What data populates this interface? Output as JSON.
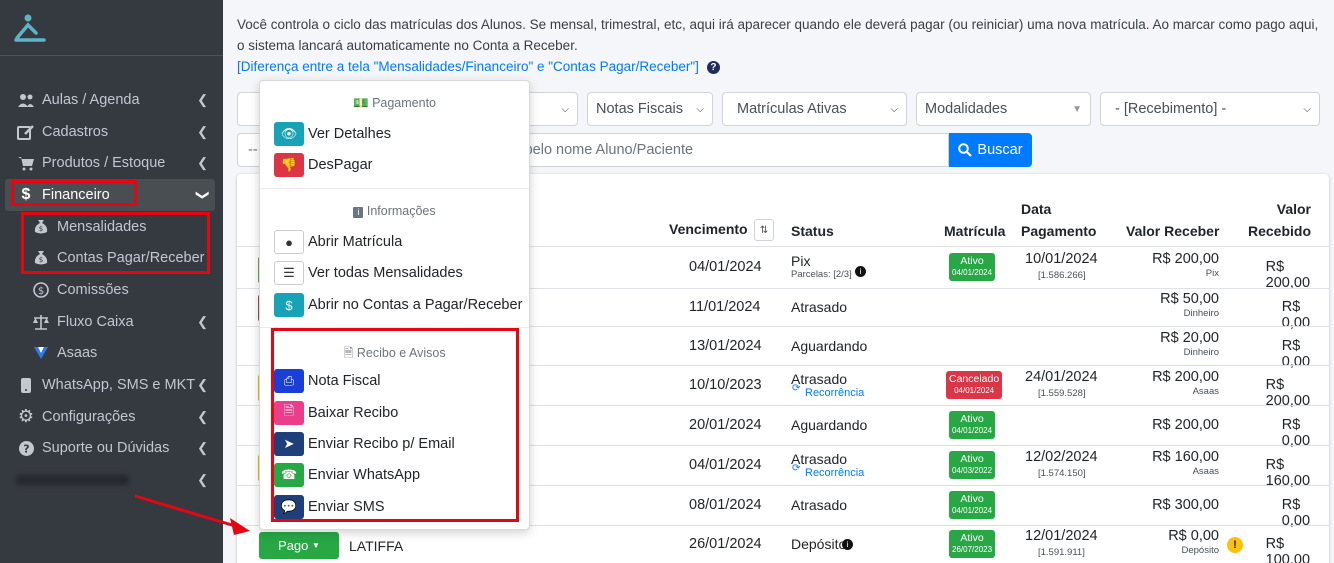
{
  "colors": {
    "sidebar": "#343a40",
    "primary": "#007bff",
    "success": "#28a745",
    "danger": "#dc3545",
    "annotation": "#e30613"
  },
  "sidebar": {
    "items": [
      {
        "label": "Aulas / Agenda",
        "icon": "users-icon"
      },
      {
        "label": "Cadastros",
        "icon": "edit-icon"
      },
      {
        "label": "Produtos / Estoque",
        "icon": "cart-icon"
      },
      {
        "label": "Financeiro",
        "icon": "dollar-icon"
      },
      {
        "label": "Mensalidades",
        "icon": "money-bag-icon"
      },
      {
        "label": "Contas Pagar/Receber",
        "icon": "money-bag-icon"
      },
      {
        "label": "Comissões",
        "icon": "dollar-circle-icon"
      },
      {
        "label": "Fluxo Caixa",
        "icon": "balance-icon"
      },
      {
        "label": "Asaas",
        "icon": "asaas-icon"
      },
      {
        "label": "WhatsApp, SMS e MKT",
        "icon": "mobile-icon"
      },
      {
        "label": "Configurações",
        "icon": "gear-icon"
      },
      {
        "label": "Suporte ou Dúvidas",
        "icon": "question-icon"
      }
    ]
  },
  "intro": {
    "text": "Você controla o ciclo das matrículas dos Alunos. Se mensal, trimestral, etc, aqui irá aparecer quando ele deverá pagar (ou reiniciar) uma nova matrícula. Ao marcar como pago aqui, o sistema lancará automaticamente no Conta a Receber.",
    "link": "[Diferença entre a tela \"Mensalidades/Financeiro\" e \"Contas Pagar/Receber\"]"
  },
  "filters": {
    "notas": "Notas Fiscais",
    "matriculas": "Matrículas Ativas",
    "modalidades": "Modalidades",
    "recebimento": "- [Recebimento] -",
    "dash": "--",
    "search_placeholder": "ar pelo nome Aluno/Paciente",
    "buscar": "Buscar"
  },
  "table": {
    "headers": {
      "vencimento": "Vencimento",
      "status": "Status",
      "matricula": "Matrícula",
      "data_pagamento_1": "Data",
      "data_pagamento_2": "Pagamento",
      "valor_receber": "Valor Receber",
      "valor_recebido_1": "Valor",
      "valor_recebido_2": "Recebido"
    },
    "rows": [
      {
        "venc": "04/01/2024",
        "status": "Pix",
        "status_sub": "Parcelas: [2/3]",
        "mat": "Ativo",
        "mat_date": "04/01/2024",
        "mat_color": "green",
        "pag": "10/01/2024",
        "pag_sub": "[1.586.266]",
        "receber": "R$ 200,00",
        "receber_sub": "Pix",
        "recebido": "R$ 200,00"
      },
      {
        "venc": "11/01/2024",
        "status": "Atrasado",
        "status_sub": "",
        "mat": "",
        "mat_date": "",
        "mat_color": "",
        "pag": "",
        "pag_sub": "",
        "receber": "R$ 50,00",
        "receber_sub": "Dinheiro",
        "recebido": "R$ 0,00"
      },
      {
        "venc": "13/01/2024",
        "status": "Aguardando",
        "status_sub": "",
        "mat": "",
        "mat_date": "",
        "mat_color": "",
        "pag": "",
        "pag_sub": "",
        "receber": "R$ 20,00",
        "receber_sub": "Dinheiro",
        "recebido": "R$ 0,00"
      },
      {
        "venc": "10/10/2023",
        "status": "Atrasado",
        "status_sub": "Recorrência",
        "mat": "Cancelado",
        "mat_date": "04/01/2024",
        "mat_color": "red",
        "pag": "24/01/2024",
        "pag_sub": "[1.559.528]",
        "receber": "R$ 200,00",
        "receber_sub": "Asaas",
        "recebido": "R$ 200,00"
      },
      {
        "venc": "20/01/2024",
        "status": "Aguardando",
        "status_sub": "",
        "mat": "Ativo",
        "mat_date": "04/01/2024",
        "mat_color": "green",
        "pag": "",
        "pag_sub": "",
        "receber": "R$ 200,00",
        "receber_sub": "",
        "recebido": "R$ 0,00"
      },
      {
        "venc": "04/01/2024",
        "status": "Atrasado",
        "status_sub": "Recorrência",
        "mat": "Ativo",
        "mat_date": "04/03/2022",
        "mat_color": "green",
        "pag": "12/02/2024",
        "pag_sub": "[1.574.150]",
        "receber": "R$ 160,00",
        "receber_sub": "Asaas",
        "recebido": "R$ 160,00"
      },
      {
        "venc": "08/01/2024",
        "status": "Atrasado",
        "status_sub": "",
        "mat": "Ativo",
        "mat_date": "04/01/2024",
        "mat_color": "green",
        "pag": "",
        "pag_sub": "",
        "receber": "R$ 300,00",
        "receber_sub": "",
        "recebido": "R$ 0,00"
      },
      {
        "venc": "26/01/2024",
        "status": "Depósito",
        "status_sub": "",
        "mat": "Ativo",
        "mat_date": "26/07/2023",
        "mat_color": "green",
        "pag": "12/01/2024",
        "pag_sub": "[1.591.911]",
        "receber": "R$ 0,00",
        "receber_sub": "Depósito",
        "recebido": "R$ 100,00",
        "name": "LATIFFA"
      }
    ]
  },
  "dropdown": {
    "pagamento": "Pagamento",
    "ver_detalhes": "Ver Detalhes",
    "despagar": "DesPagar",
    "informacoes": "Informações",
    "abrir_matricula": "Abrir Matrícula",
    "ver_mensalidades": "Ver todas Mensalidades",
    "abrir_contas": "Abrir no Contas a Pagar/Receber",
    "recibo": "Recibo e Avisos",
    "nota_fiscal": "Nota Fiscal",
    "baixar_recibo": "Baixar Recibo",
    "enviar_email": "Enviar Recibo p/ Email",
    "enviar_whatsapp": "Enviar WhatsApp",
    "enviar_sms": "Enviar SMS"
  },
  "pago_button": "Pago"
}
